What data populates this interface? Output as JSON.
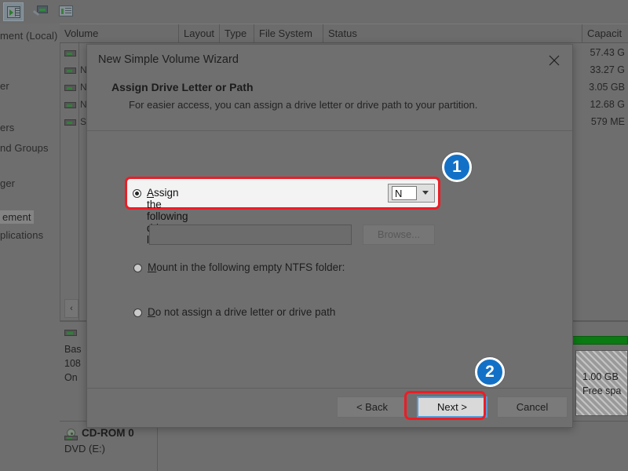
{
  "app": {
    "toolbar": {
      "buttons": [
        {
          "name": "show-hide-console-tree",
          "icon": "console-tree-icon",
          "active": true
        },
        {
          "name": "help-search",
          "icon": "magnifier-icon",
          "active": false
        },
        {
          "name": "show-action-pane",
          "icon": "action-pane-icon",
          "active": false
        }
      ]
    },
    "tree": {
      "items": [
        {
          "label": "ment (Local)",
          "selected": false
        },
        {
          "label": "er",
          "selected": false
        },
        {
          "label": "ers",
          "selected": false
        },
        {
          "label": "nd Groups",
          "selected": false
        },
        {
          "label": "ger",
          "selected": false
        },
        {
          "label": "ement",
          "selected": true
        },
        {
          "label": "plications",
          "selected": false
        }
      ]
    },
    "volume_list": {
      "columns": [
        "Volume",
        "Layout",
        "Type",
        "File System",
        "Status",
        "Capacit"
      ],
      "rows": [
        {
          "volume": "",
          "capacity": "57.43 G"
        },
        {
          "volume": "N",
          "capacity": "33.27 G"
        },
        {
          "volume": "N",
          "capacity": "3.05 GB"
        },
        {
          "volume": "N",
          "capacity": "12.68 G"
        },
        {
          "volume": "S",
          "capacity": "579 ME"
        }
      ],
      "scroll_left_arrow": "‹"
    },
    "disk_view": {
      "disk": {
        "line1": "Bas",
        "line2": "108",
        "line3": "On"
      },
      "partition": {
        "size": "1.00 GB",
        "status": "Free spa"
      },
      "cdrom": {
        "title": "CD-ROM 0",
        "subtitle": "DVD (E:)"
      }
    }
  },
  "dialog": {
    "title": "New Simple Volume Wizard",
    "close_icon": "close-icon",
    "heading": "Assign Drive Letter or Path",
    "subheading": "For easier access, you can assign a drive letter or drive path to your partition.",
    "options": {
      "assign_letter": {
        "label_pre": "A",
        "label_rest": "ssign the following drive letter:",
        "checked": true,
        "drive_letter": "N"
      },
      "mount_folder": {
        "label_pre": "M",
        "label_rest": "ount in the following empty NTFS folder:",
        "checked": false,
        "path_value": "",
        "browse_label": "Browse..."
      },
      "no_assign": {
        "label_pre": "D",
        "label_rest": "o not assign a drive letter or drive path",
        "checked": false
      }
    },
    "buttons": {
      "back": "< Back",
      "next": "Next >",
      "cancel": "Cancel"
    }
  },
  "callouts": [
    {
      "number": "1",
      "target": "drive-letter-dropdown"
    },
    {
      "number": "2",
      "target": "next-button"
    }
  ],
  "colors": {
    "callout_blue": "#1271c7",
    "highlight_red": "#ee1c25",
    "partition_green": "#0a7a12",
    "focus_blue": "#5a9bd5"
  }
}
